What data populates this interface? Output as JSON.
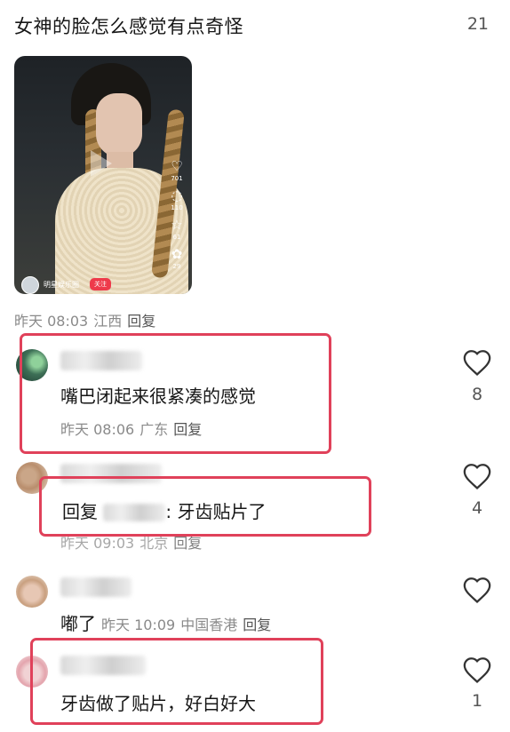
{
  "post": {
    "title": "女神的脸怎么感觉有点奇怪",
    "likes": "21",
    "meta_time": "昨天 08:03",
    "meta_location": "江西",
    "meta_reply": "回复"
  },
  "video": {
    "author": "明星娱乐圈",
    "follow_label": "关注",
    "actions": [
      {
        "icon": "heart-icon",
        "count": "701"
      },
      {
        "icon": "comment-icon",
        "count": "110"
      },
      {
        "icon": "star-icon",
        "count": "61"
      },
      {
        "icon": "share-icon",
        "count": "29"
      }
    ]
  },
  "comments": [
    {
      "username": "",
      "text": "嘴巴闭起来很紧凑的感觉",
      "time": "昨天 08:06",
      "location": "广东",
      "reply_label": "回复",
      "likes": "8"
    },
    {
      "username": "",
      "reply_prefix": "回复",
      "reply_to": "",
      "text": ": 牙齿贴片了",
      "time": "昨天 09:03",
      "location": "北京",
      "reply_label": "回复",
      "likes": "4"
    },
    {
      "username": "",
      "text": "嘟了",
      "time": "昨天 10:09",
      "location": "中国香港",
      "reply_label": "回复",
      "likes": ""
    },
    {
      "username": "",
      "text": "牙齿做了贴片，好白好大",
      "likes": "1"
    }
  ],
  "colors": {
    "highlight_box": "#e0415a",
    "meta_text": "#8a8a8a"
  }
}
